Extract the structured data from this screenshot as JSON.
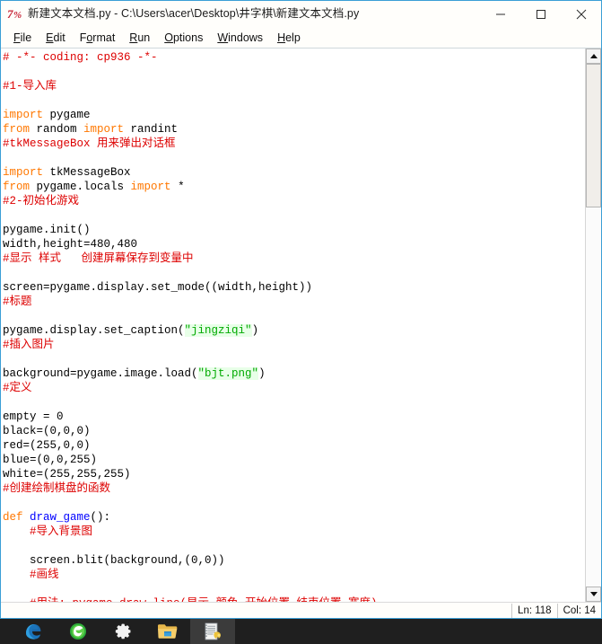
{
  "window": {
    "title": "新建文本文档.py - C:\\Users\\acer\\Desktop\\井字棋\\新建文本文档.py",
    "app_icon": "idle-python-icon",
    "controls": {
      "minimize": "−",
      "maximize": "□",
      "close": "✕"
    }
  },
  "menubar": {
    "items": [
      {
        "label": "File",
        "mnemonic": "F",
        "rest": "ile"
      },
      {
        "label": "Edit",
        "mnemonic": "E",
        "rest": "dit"
      },
      {
        "label": "Format",
        "mnemonic": "F",
        "rest": "ormat",
        "pre": ""
      },
      {
        "label": "Run",
        "mnemonic": "R",
        "rest": "un"
      },
      {
        "label": "Options",
        "mnemonic": "O",
        "rest": "ptions"
      },
      {
        "label": "Windows",
        "mnemonic": "W",
        "rest": "indows"
      },
      {
        "label": "Help",
        "mnemonic": "H",
        "rest": "elp"
      }
    ]
  },
  "editor": {
    "lines": [
      "# -*- coding: cp936 -*-",
      "",
      "#1-导入库",
      "",
      "import pygame",
      "from random import randint",
      "#tkMessageBox 用来弹出对话框",
      "",
      "import tkMessageBox",
      "from pygame.locals import *",
      "#2-初始化游戏",
      "",
      "pygame.init()",
      "width,height=480,480",
      "#显示 样式   创建屏幕保存到变量中",
      "",
      "screen=pygame.display.set_mode((width,height))",
      "#标题",
      "",
      "pygame.display.set_caption(\"jingziqi\")",
      "#插入图片",
      "",
      "background=pygame.image.load(\"bjt.png\")",
      "#定义",
      "",
      "empty = 0",
      "black=(0,0,0)",
      "red=(255,0,0)",
      "blue=(0,0,255)",
      "white=(255,255,255)",
      "#创建绘制棋盘的函数",
      "",
      "def draw_game():",
      "    #导入背景图",
      "",
      "    screen.blit(background,(0,0))",
      "    #画线",
      "",
      "    #用法: pygame.draw.line(显示,颜色,开始位置,结束位置,宽度)"
    ]
  },
  "statusbar": {
    "line_label": "Ln: 118",
    "col_label": "Col: 14"
  },
  "scrollbar": {
    "up_arrow": "scroll-up-arrow",
    "down_arrow": "scroll-down-arrow"
  },
  "taskbar": {
    "items": [
      {
        "name": "edge-browser-icon",
        "label": "Microsoft Edge"
      },
      {
        "name": "360-browser-icon",
        "label": "360 Browser"
      },
      {
        "name": "settings-gear-icon",
        "label": "Settings"
      },
      {
        "name": "file-explorer-icon",
        "label": "File Explorer"
      },
      {
        "name": "python-idle-icon",
        "label": "IDLE"
      }
    ]
  },
  "colors": {
    "comment": "#dd0000",
    "keyword": "#ff7700",
    "string": "#00aa00",
    "definition": "#0000ff",
    "window_border": "#3b9fd6",
    "taskbar_bg": "#1f1f1f"
  }
}
